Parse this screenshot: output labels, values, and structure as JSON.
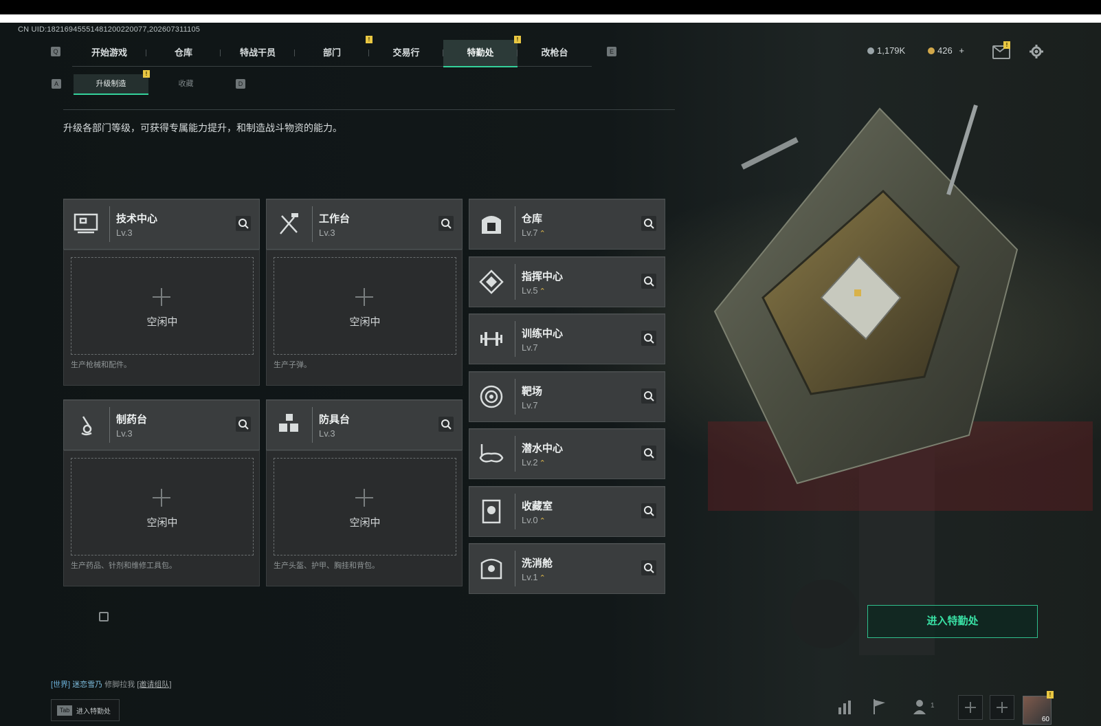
{
  "uid": "CN UID:18216945551481200220077,202607311105",
  "nav": {
    "left_key": "Q",
    "right_key": "E",
    "tabs": [
      {
        "label": "开始游戏",
        "badge": ""
      },
      {
        "label": "仓库",
        "badge": ""
      },
      {
        "label": "特战干员",
        "badge": ""
      },
      {
        "label": "部门",
        "badge": "!"
      },
      {
        "label": "交易行",
        "badge": ""
      },
      {
        "label": "特勤处",
        "badge": "!",
        "active": true
      },
      {
        "label": "改枪台",
        "badge": ""
      }
    ]
  },
  "subnav": {
    "left_key": "A",
    "right_key": "D",
    "tabs": [
      {
        "label": "升级制造",
        "badge": "!",
        "active": true
      },
      {
        "label": "收藏",
        "badge": ""
      }
    ]
  },
  "currency": {
    "silver": "1,179K",
    "gold": "426",
    "plus": "+"
  },
  "header": {
    "mail_badge": "!",
    "description": "升级各部门等级，可获得专属能力提升，和制造战斗物资的能力。"
  },
  "workbenches": [
    {
      "name": "技术中心",
      "level": "Lv.3",
      "icon": "computer-icon",
      "idle": "空闲中",
      "hint": "生产枪械和配件。"
    },
    {
      "name": "工作台",
      "level": "Lv.3",
      "icon": "tools-icon",
      "idle": "空闲中",
      "hint": "生产子弹。"
    },
    {
      "name": "制药台",
      "level": "Lv.3",
      "icon": "microscope-icon",
      "idle": "空闲中",
      "hint": "生产药品、针剂和维修工具包。"
    },
    {
      "name": "防具台",
      "level": "Lv.3",
      "icon": "armor-boxes-icon",
      "idle": "空闲中",
      "hint": "生产头盔、护甲、胸挂和背包。"
    }
  ],
  "facilities": [
    {
      "name": "仓库",
      "level": "Lv.7",
      "upgradable": true,
      "icon": "warehouse-icon"
    },
    {
      "name": "指挥中心",
      "level": "Lv.5",
      "upgradable": true,
      "icon": "command-diamond-icon"
    },
    {
      "name": "训练中心",
      "level": "Lv.7",
      "upgradable": false,
      "icon": "dumbbell-icon"
    },
    {
      "name": "靶场",
      "level": "Lv.7",
      "upgradable": false,
      "icon": "target-icon"
    },
    {
      "name": "潜水中心",
      "level": "Lv.2",
      "upgradable": true,
      "icon": "diving-mask-icon"
    },
    {
      "name": "收藏室",
      "level": "Lv.0",
      "upgradable": true,
      "icon": "collection-icon"
    },
    {
      "name": "洗消舱",
      "level": "Lv.1",
      "upgradable": true,
      "icon": "decon-icon"
    }
  ],
  "enter_button": "进入特勤处",
  "chat": {
    "channel": "[世界]",
    "user": "迷恋雪乃",
    "message": "修脚拉我",
    "invite": "[邀请组队]"
  },
  "tab_hint": {
    "key": "Tab",
    "label": "进入特勤处"
  },
  "bottom": {
    "squad_count": "1",
    "avatar_level": "60",
    "avatar_badge": "!"
  },
  "colors": {
    "accent": "#34d29b",
    "badge": "#e9c742",
    "upgrade_arrow": "#e0b94a"
  }
}
